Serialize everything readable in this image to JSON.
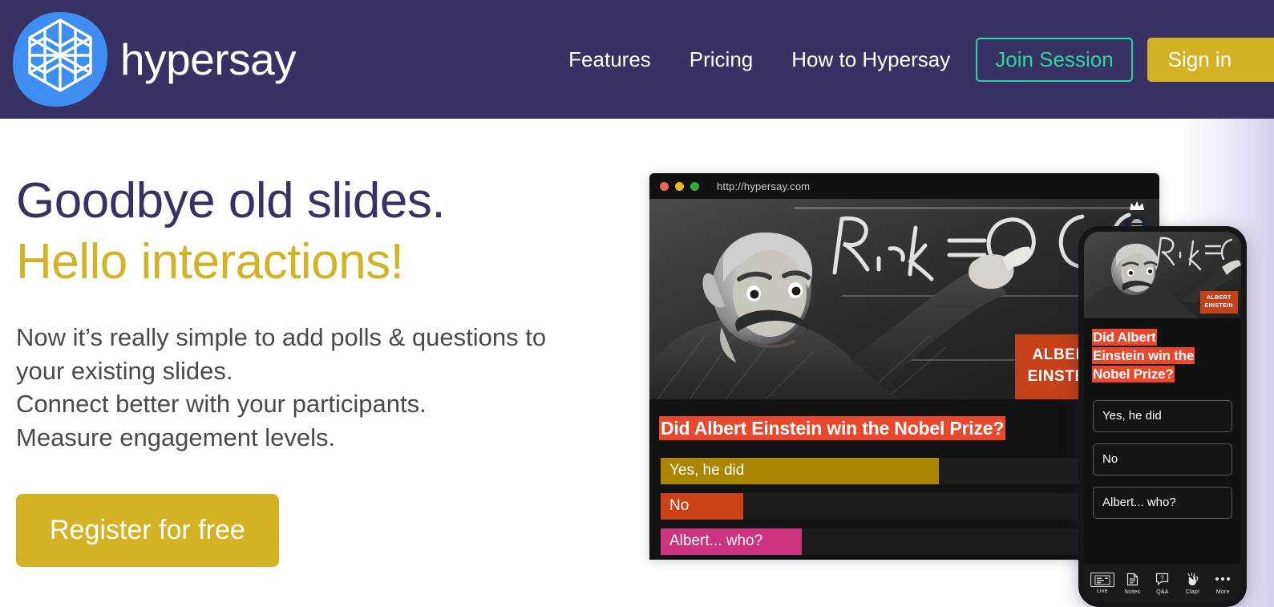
{
  "brand": {
    "name": "hypersay",
    "logo_icon": "hexagon-geodesic-logo",
    "logo_color": "#3d8ef0"
  },
  "nav": {
    "links": [
      {
        "label": "Features"
      },
      {
        "label": "Pricing"
      },
      {
        "label": "How to Hypersay"
      }
    ],
    "join_label": "Join Session",
    "signin_label": "Sign in",
    "bar_color": "#383163",
    "join_color": "#2bd99a",
    "signin_color": "#d4b226"
  },
  "hero": {
    "headline_line1": "Goodbye old slides.",
    "headline_line2": "Hello interactions!",
    "headline_color1": "#383163",
    "headline_color2": "#d4b226",
    "paragraph_lines": [
      "Now it’s really simple to add polls & questions to",
      "your existing slides.",
      "Connect better with your participants.",
      "Measure engagement levels."
    ],
    "cta_label": "Register for free"
  },
  "browser": {
    "url": "http://hypersay.com",
    "traffic_lights": [
      "close-red",
      "minimize-yellow",
      "maximize-green"
    ],
    "slide": {
      "image_alt": "Albert Einstein writing equations on a blackboard",
      "badge_line1": "ALBERT",
      "badge_line2": "EINSTEIN",
      "badge_color": "#c5411a"
    },
    "presenter": {
      "crown_icon": "crown-icon",
      "avatar_icon": "presenter-avatar"
    },
    "poll": {
      "question": "Did Albert Einstein win the Nobel Prize?",
      "highlight_color": "#e8482b",
      "options": [
        {
          "label": "Yes, he did",
          "percent": 57,
          "color": "#aa8500"
        },
        {
          "label": "No",
          "percent": 17,
          "color": "#cc4116"
        },
        {
          "label": "Albert... who?",
          "percent": 29,
          "color": "#cc3380"
        }
      ]
    }
  },
  "phone": {
    "badge_line1": "ALBERT",
    "badge_line2": "EINSTEIN",
    "question_parts": [
      "Did Albert",
      "Einstein win the",
      "Nobel Prize?"
    ],
    "options": [
      {
        "label": "Yes, he did"
      },
      {
        "label": "No"
      },
      {
        "label": "Albert... who?"
      }
    ],
    "tabs": [
      {
        "label": "Live",
        "icon": "live-slide-icon",
        "glyph": "▤",
        "active": true
      },
      {
        "label": "Notes",
        "icon": "notes-document-icon",
        "glyph": "☰",
        "active": false
      },
      {
        "label": "Q&A",
        "icon": "question-bubble-icon",
        "glyph": "?",
        "active": false
      },
      {
        "label": "Clap!",
        "icon": "clapping-hands-icon",
        "glyph": "👏",
        "active": false
      },
      {
        "label": "More",
        "icon": "ellipsis-icon",
        "glyph": "•••",
        "active": false
      }
    ]
  }
}
